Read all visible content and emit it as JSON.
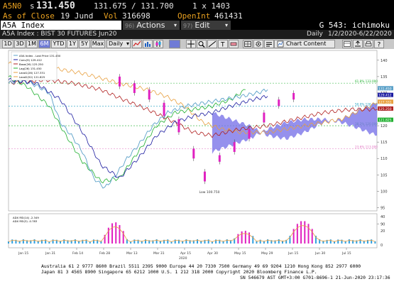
{
  "quote": {
    "ticker": "A5N0",
    "price_prefix": "s",
    "last_price": "131.450",
    "bid_ask": "131.675 / 131.700",
    "size": "1 x 1403",
    "as_of_label": "As of Close",
    "as_of_date": "19 Jund",
    "vol_label": "Vol",
    "vol_value": "316698",
    "openint_label": "OpenInt",
    "openint_value": "461431"
  },
  "command": {
    "security": "A5A Index",
    "actions_num": "96)",
    "actions_label": "Actions",
    "edit_num": "97)",
    "edit_label": "Edit",
    "page_label": "G 543: ichimoku"
  },
  "subheader": {
    "left": "A5A Index : BIST 30 FUTURES  Jun20",
    "periodicity": "Daily",
    "date_range": "1/2/2020-6/22/2020"
  },
  "toolbar": {
    "ranges": [
      "1D",
      "3D",
      "1M",
      "6M",
      "YTD",
      "1Y",
      "5Y",
      "Max"
    ],
    "selected_range": "6M",
    "period_select": "Daily",
    "chart_content": "Chart Content"
  },
  "chart_data": [
    {
      "type": "line",
      "title": "",
      "legend": [
        "A5A Index - Last Price 131.450",
        "Conv(9) 129.412",
        "Base(26) 125.250",
        "Lag(26) 131.450",
        "Lead1(26) 127.331",
        "Lead2(52) 121.825"
      ],
      "price_axis": [
        "140",
        "135",
        "130",
        "125",
        "120",
        "115",
        "110",
        "105",
        "100",
        "95",
        "90"
      ],
      "right_markers": [
        "131.450",
        "129.412",
        "127.331",
        "125.250",
        "121.825"
      ],
      "fib_labels": [
        "61.8% 133.000",
        "50.0% 126.000",
        "38.2% 120.000",
        "23.6% 113.000"
      ],
      "low_annotation": "Low 100.750",
      "date_labels": [
        "Jan 15",
        "Jan 31",
        "Feb 14",
        "Feb 28",
        "Mar 13",
        "Mar 31",
        "Apr 15",
        "Apr 30",
        "May 15",
        "May 29",
        "Jun 15",
        "Jun 30",
        "Jul 15"
      ],
      "year_label": "2020",
      "ylim": [
        94,
        143
      ]
    },
    {
      "type": "bar",
      "legend": [
        "ADX RSI(14) -2.349",
        "ADX RSI(3) -0.783"
      ],
      "axis": [
        "40",
        "20",
        "0"
      ]
    }
  ],
  "footer": {
    "line1": "Australia 61 2 9777 8600 Brazil 5511 2395 9000 Europe 44 20 7330 7500 Germany 49 69 9204 1210 Hong Kong 852 2977 6000",
    "line2": "Japan 81 3 4565 8900        Singapore 65 6212 1000        U.S. 1 212 318 2000            Copyright 2020 Bloomberg Finance L.P.",
    "line3": "SN 546679 AST  GMT+3:00 G701-8696-1 21-Jun-2020 23:17:36"
  },
  "colors": {
    "amber": "#e8a020",
    "cloud": "#7b74e8",
    "price_line": "#5aa0c8",
    "conv_line": "#1a1aa0",
    "base_line": "#b02020",
    "lead_line": "#e8a040",
    "lag_line": "#20b030",
    "candle": "#e020c0"
  }
}
